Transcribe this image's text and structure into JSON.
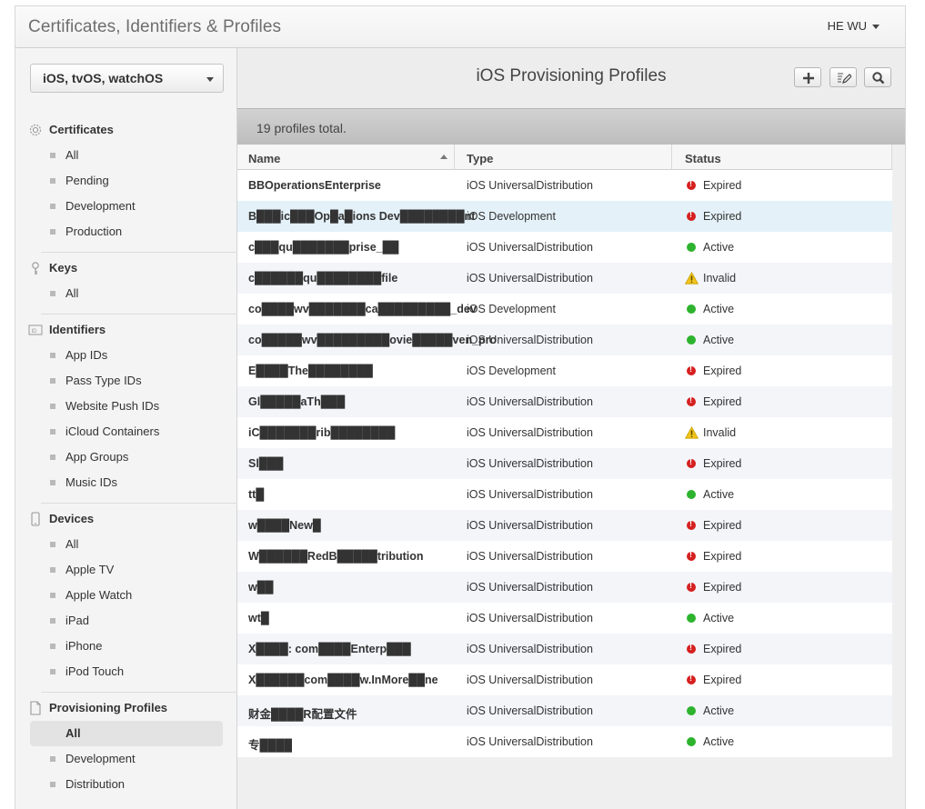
{
  "header": {
    "title": "Certificates, Identifiers & Profiles",
    "user": "HE WU"
  },
  "sidebar": {
    "platform": "iOS, tvOS, watchOS",
    "sections": [
      {
        "title": "Certificates",
        "icon": "gear-icon",
        "items": [
          "All",
          "Pending",
          "Development",
          "Production"
        ]
      },
      {
        "title": "Keys",
        "icon": "key-icon",
        "items": [
          "All"
        ]
      },
      {
        "title": "Identifiers",
        "icon": "id-icon",
        "items": [
          "App IDs",
          "Pass Type IDs",
          "Website Push IDs",
          "iCloud Containers",
          "App Groups",
          "Music IDs"
        ]
      },
      {
        "title": "Devices",
        "icon": "device-icon",
        "items": [
          "All",
          "Apple TV",
          "Apple Watch",
          "iPad",
          "iPhone",
          "iPod Touch"
        ]
      },
      {
        "title": "Provisioning Profiles",
        "icon": "document-icon",
        "items": [
          "All",
          "Development",
          "Distribution"
        ],
        "active": "All"
      }
    ]
  },
  "main": {
    "title": "iOS Provisioning Profiles",
    "count_text": "19 profiles total.",
    "columns": [
      "Name",
      "Type",
      "Status"
    ],
    "rows": [
      {
        "name": "BBOperationsEnterprise",
        "type": "iOS UniversalDistribution",
        "status": "Expired"
      },
      {
        "name": "B███ic███Op█a█ions Dev████████nt",
        "type": "iOS Development",
        "status": "Expired"
      },
      {
        "name": "c███qu███████prise_██",
        "type": "iOS UniversalDistribution",
        "status": "Active"
      },
      {
        "name": "c██████qu████████file",
        "type": "iOS UniversalDistribution",
        "status": "Invalid"
      },
      {
        "name": "co████wv███████ca█████████_dev",
        "type": "iOS Development",
        "status": "Active"
      },
      {
        "name": "co█████wv█████████ovie█████ven_pro",
        "type": "iOS UniversalDistribution",
        "status": "Active"
      },
      {
        "name": "E████The████████",
        "type": "iOS Development",
        "status": "Expired"
      },
      {
        "name": "Gl█████aTh███",
        "type": "iOS UniversalDistribution",
        "status": "Expired"
      },
      {
        "name": "iC███████rib████████",
        "type": "iOS UniversalDistribution",
        "status": "Invalid"
      },
      {
        "name": "Sl███",
        "type": "iOS UniversalDistribution",
        "status": "Expired"
      },
      {
        "name": "tt█",
        "type": "iOS UniversalDistribution",
        "status": "Active"
      },
      {
        "name": "w████New█",
        "type": "iOS UniversalDistribution",
        "status": "Expired"
      },
      {
        "name": "W██████RedB█████tribution",
        "type": "iOS UniversalDistribution",
        "status": "Expired"
      },
      {
        "name": "w██",
        "type": "iOS UniversalDistribution",
        "status": "Expired"
      },
      {
        "name": "wt█",
        "type": "iOS UniversalDistribution",
        "status": "Active"
      },
      {
        "name": "X████: com████Enterp███",
        "type": "iOS UniversalDistribution",
        "status": "Expired"
      },
      {
        "name": "X██████com████w.InMore██ne",
        "type": "iOS UniversalDistribution",
        "status": "Expired"
      },
      {
        "name": "财金████R配置文件",
        "type": "iOS UniversalDistribution",
        "status": "Active"
      },
      {
        "name": "专████",
        "type": "iOS UniversalDistribution",
        "status": "Active"
      }
    ]
  },
  "colors": {
    "active": "#2eb32e",
    "expired": "#d62020",
    "invalid": "#f0c419",
    "selected_row": "#e4f1f8"
  }
}
